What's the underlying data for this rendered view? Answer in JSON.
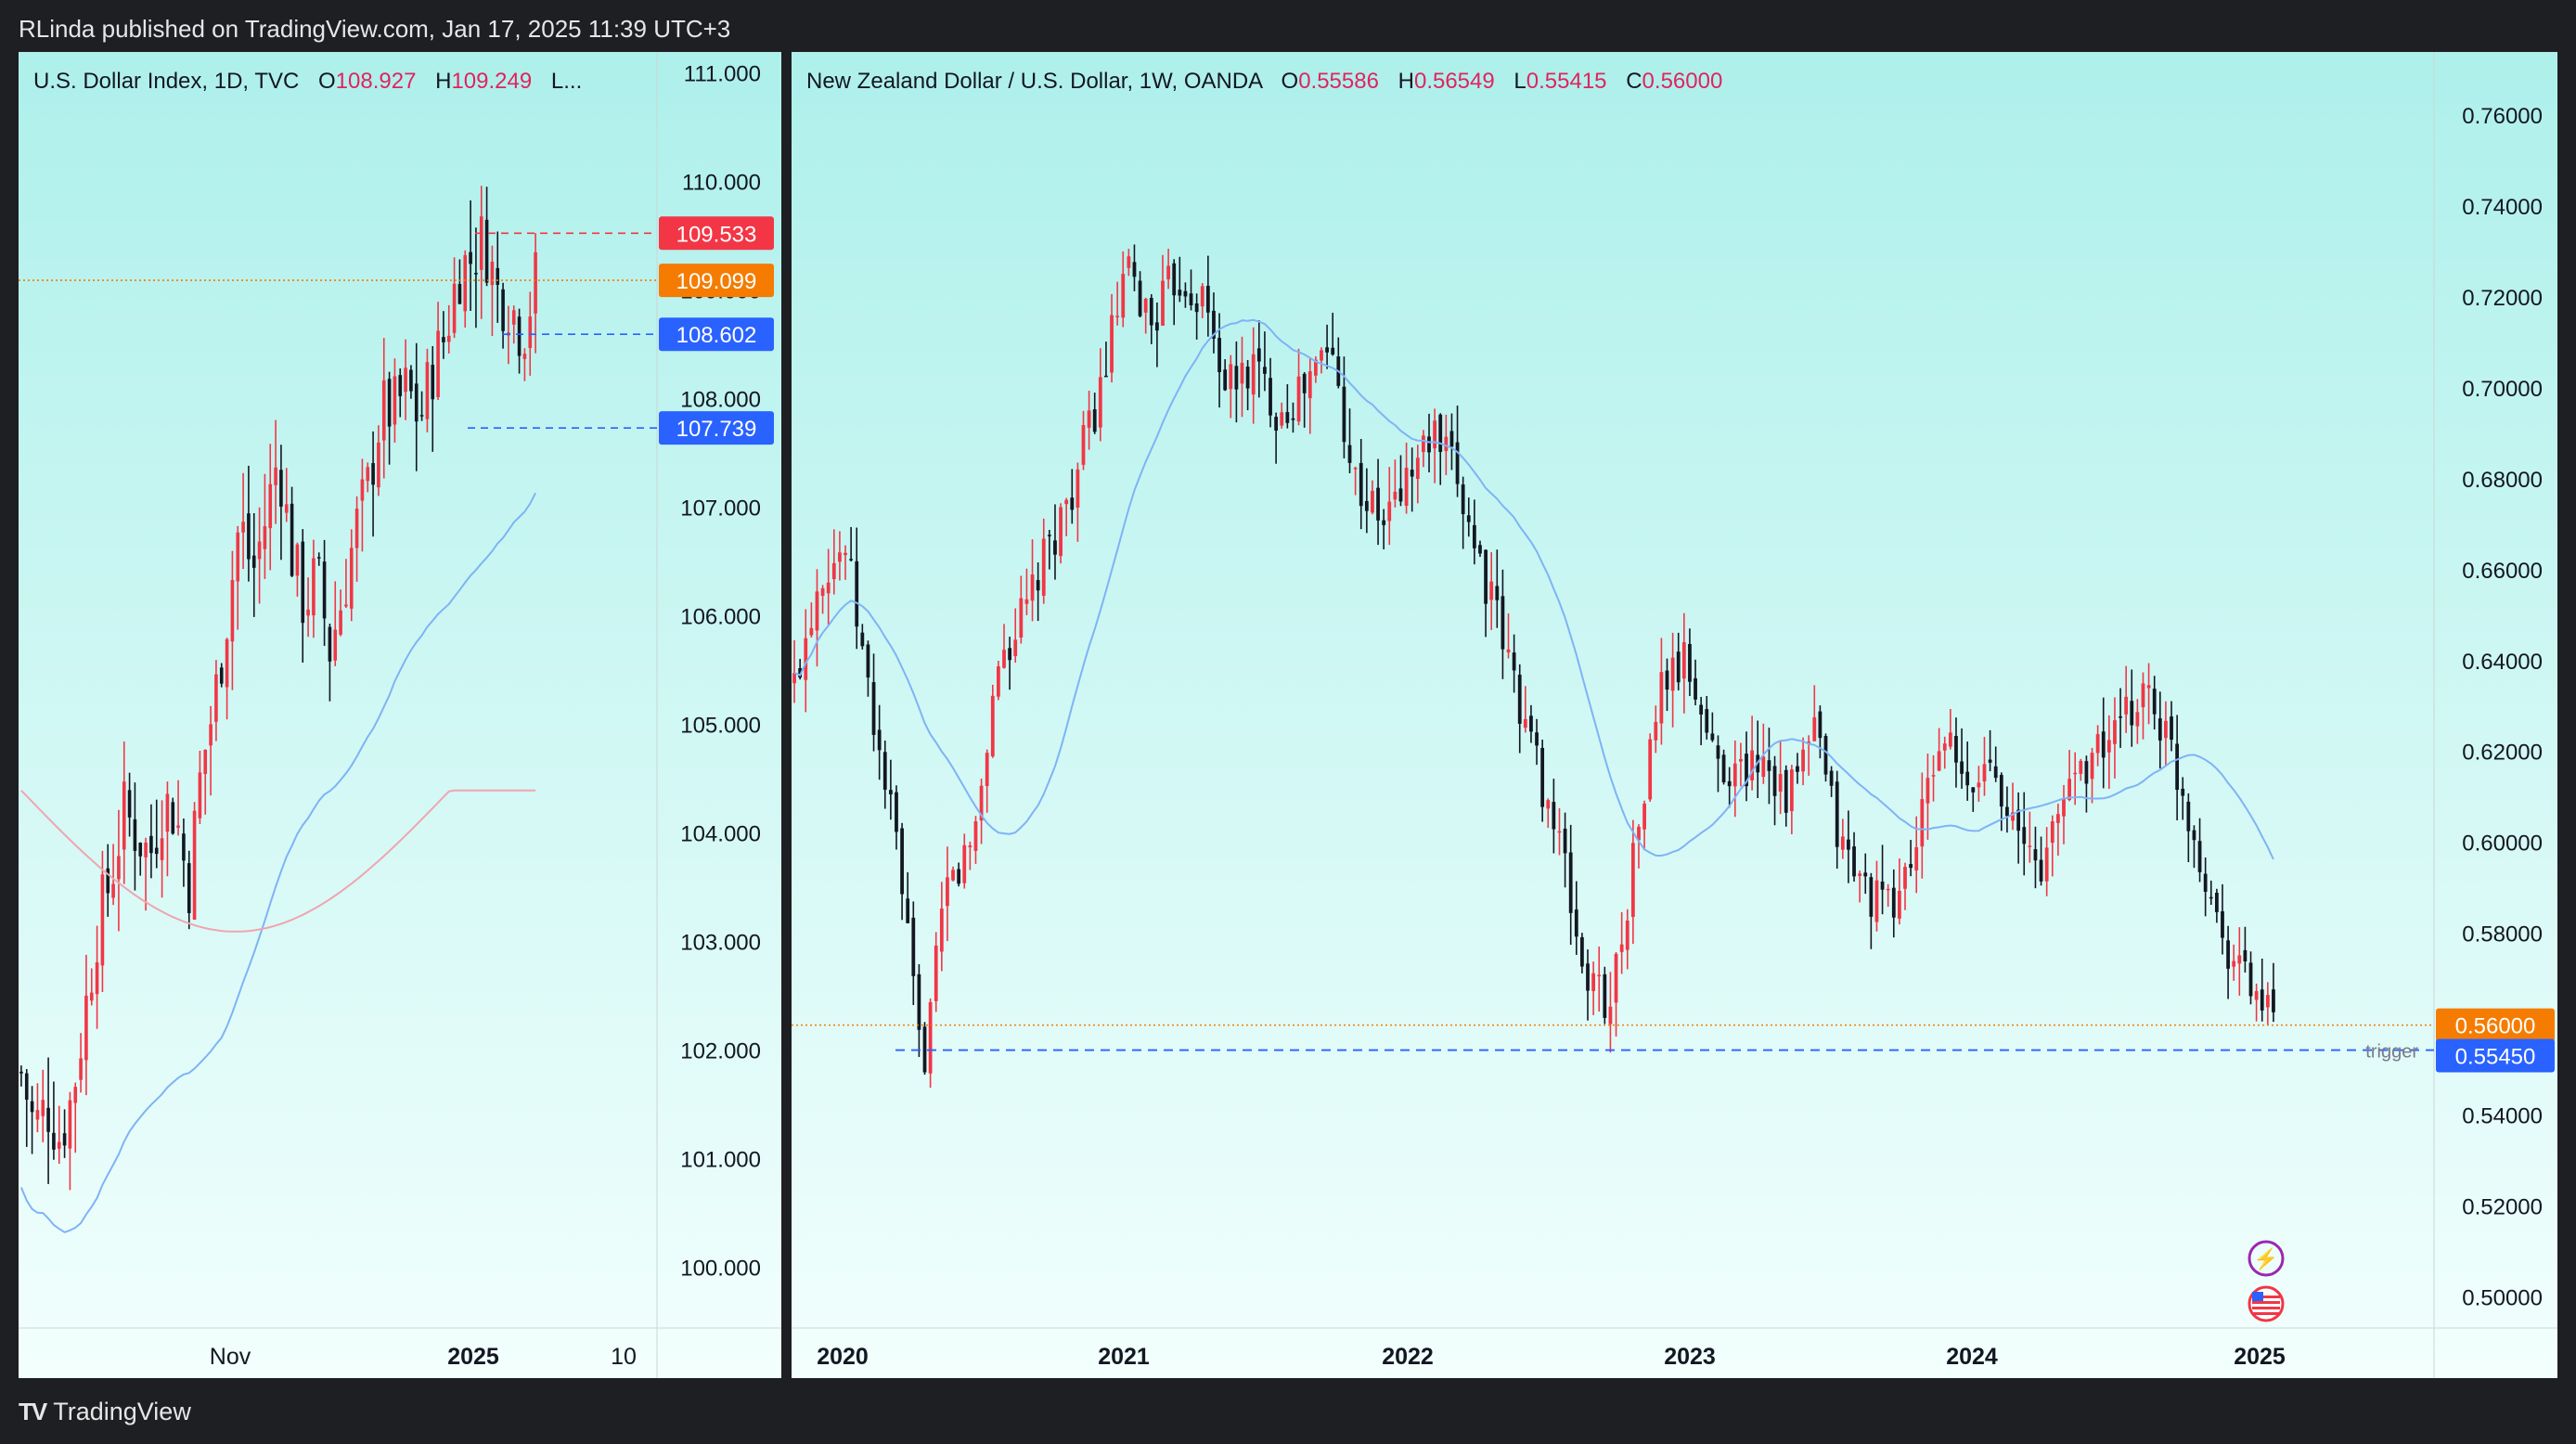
{
  "header": {
    "published": "RLinda published on TradingView.com, Jan 17, 2025 11:39 UTC+3"
  },
  "footer": {
    "brand": "TradingView"
  },
  "colors": {
    "up": "#f23645",
    "down": "#131722",
    "ma_blue": "#7fb3f5",
    "ma_pink": "#f0a5b0",
    "last": "#f57c00",
    "red_level": "#f23645",
    "blue_level": "#2962ff"
  },
  "left": {
    "legend": {
      "symbol": "U.S. Dollar Index, 1D, TVC",
      "o_key": "O",
      "o_val": "108.927",
      "h_key": "H",
      "h_val": "109.249",
      "l_key": "L..."
    },
    "y_ticks": [
      "111.000",
      "110.000",
      "109.000",
      "108.000",
      "107.000",
      "106.000",
      "105.000",
      "104.000",
      "103.000",
      "102.000",
      "101.000",
      "100.000"
    ],
    "x_ticks": [
      "Nov",
      "2025",
      "10"
    ],
    "levels": {
      "red": "109.533",
      "last": "109.099",
      "blue1": "108.602",
      "blue2": "107.739"
    }
  },
  "right": {
    "legend": {
      "symbol": "New Zealand Dollar / U.S. Dollar, 1W, OANDA",
      "o_key": "O",
      "o_val": "0.55586",
      "h_key": "H",
      "h_val": "0.56549",
      "l_key": "L",
      "l_val": "0.55415",
      "c_key": "C",
      "c_val": "0.56000"
    },
    "y_ticks": [
      "0.76000",
      "0.74000",
      "0.72000",
      "0.70000",
      "0.68000",
      "0.66000",
      "0.64000",
      "0.62000",
      "0.60000",
      "0.58000",
      "0.56000",
      "0.54000",
      "0.52000",
      "0.50000"
    ],
    "x_ticks": [
      "2020",
      "2021",
      "2022",
      "2023",
      "2024",
      "2025"
    ],
    "levels": {
      "last": "0.56000",
      "trigger_price": "0.55450",
      "trigger_label": "trigger"
    }
  },
  "chart_data": [
    {
      "type": "candlestick",
      "title": "U.S. Dollar Index, 1D, TVC",
      "ylim": [
        99.5,
        111.1
      ],
      "x_labels": [
        "Nov",
        "2025",
        "10"
      ],
      "close_path": [
        101.8,
        101.3,
        101.5,
        101.2,
        101.6,
        102.4,
        103.2,
        103.6,
        104.2,
        104.0,
        103.8,
        104.3,
        104.2,
        103.5,
        104.6,
        105.2,
        106.0,
        106.9,
        106.4,
        106.9,
        107.5,
        106.6,
        106.1,
        106.4,
        105.7,
        106.2,
        106.8,
        107.2,
        107.9,
        107.9,
        108.1,
        107.8,
        108.3,
        108.6,
        109.2,
        109.3,
        109.5,
        109.0,
        108.9,
        108.6,
        109.1
      ],
      "moving_averages": {
        "blue": "rising",
        "pink": "flat"
      },
      "levels": [
        109.533,
        109.099,
        108.602,
        107.739
      ]
    },
    {
      "type": "candlestick",
      "title": "New Zealand Dollar / U.S. Dollar, 1W, OANDA",
      "ylim": [
        0.495,
        0.77
      ],
      "x_labels": [
        "2020",
        "2021",
        "2022",
        "2023",
        "2024",
        "2025"
      ],
      "ohlc_last": {
        "o": 0.55586,
        "h": 0.56549,
        "l": 0.55415,
        "c": 0.56
      },
      "close_path": [
        0.635,
        0.66,
        0.665,
        0.63,
        0.6,
        0.55,
        0.59,
        0.6,
        0.64,
        0.65,
        0.665,
        0.68,
        0.7,
        0.725,
        0.715,
        0.725,
        0.72,
        0.7,
        0.705,
        0.695,
        0.7,
        0.71,
        0.68,
        0.67,
        0.68,
        0.69,
        0.68,
        0.66,
        0.64,
        0.62,
        0.6,
        0.57,
        0.565,
        0.6,
        0.635,
        0.64,
        0.62,
        0.615,
        0.62,
        0.61,
        0.625,
        0.6,
        0.59,
        0.585,
        0.6,
        0.625,
        0.61,
        0.62,
        0.6,
        0.595,
        0.615,
        0.62,
        0.625,
        0.635,
        0.62,
        0.6,
        0.58,
        0.57,
        0.56
      ],
      "moving_averages": {
        "blue": "smooth"
      },
      "levels": [
        0.56,
        0.5545
      ]
    }
  ]
}
